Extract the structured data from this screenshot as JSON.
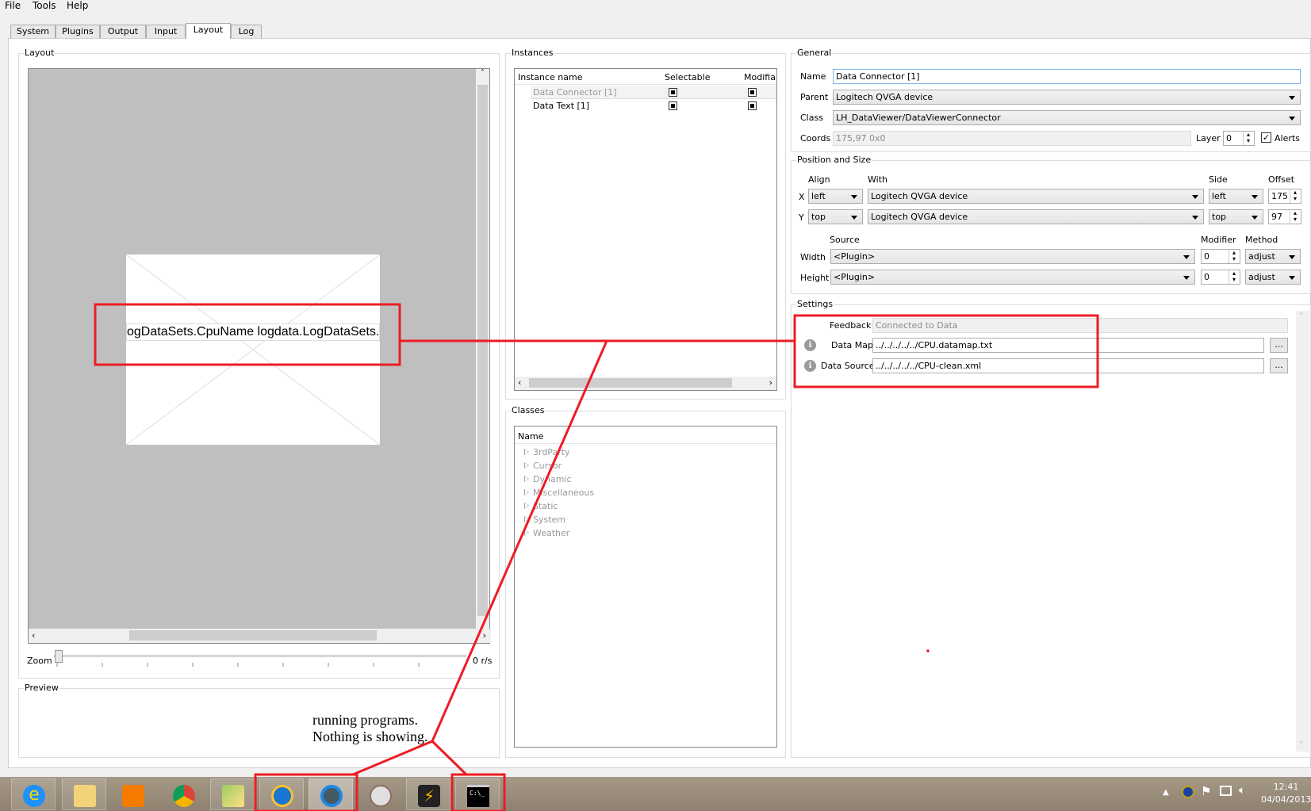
{
  "menu": [
    "File",
    "Tools",
    "Help"
  ],
  "tabs": [
    "System",
    "Plugins",
    "Output",
    "Input",
    "Layout",
    "Log"
  ],
  "active_tab": "Layout",
  "layout": {
    "title": "Layout",
    "canvas_text": "ogDataSets.CpuName logdata.LogDataSets.",
    "zoom_label": "Zoom",
    "rate": "0 r/s",
    "zoom_value": 0
  },
  "preview": {
    "title": "Preview"
  },
  "instances": {
    "title": "Instances",
    "columns": [
      "Instance name",
      "Selectable",
      "Modifiable"
    ],
    "rows": [
      {
        "name": "Data Connector [1]",
        "selectable": true,
        "modifiable": true
      },
      {
        "name": "Data Text [1]",
        "selectable": true,
        "modifiable": true
      }
    ]
  },
  "classes": {
    "title": "Classes",
    "column": "Name",
    "items": [
      "3rdParty",
      "Cursor",
      "Dynamic",
      "Miscellaneous",
      "Static",
      "System",
      "Weather"
    ]
  },
  "general": {
    "title": "General",
    "name_label": "Name",
    "name": "Data Connector [1]",
    "parent_label": "Parent",
    "parent": "Logitech QVGA device",
    "class_label": "Class",
    "class": "LH_DataViewer/DataViewerConnector",
    "coords_label": "Coords",
    "coords": "175,97 0x0",
    "layer_label": "Layer",
    "layer": "0",
    "alerts_label": "Alerts",
    "alerts": true
  },
  "position": {
    "title": "Position and Size",
    "h_align": "Align",
    "h_with": "With",
    "h_side": "Side",
    "h_offset": "Offset",
    "x": {
      "label": "X",
      "align": "left",
      "with": "Logitech QVGA device",
      "side": "left",
      "offset": "175"
    },
    "y": {
      "label": "Y",
      "align": "top",
      "with": "Logitech QVGA device",
      "side": "top",
      "offset": "97"
    },
    "h_source": "Source",
    "h_modifier": "Modifier",
    "h_method": "Method",
    "width": {
      "label": "Width",
      "source": "<Plugin>",
      "modifier": "0",
      "method": "adjust"
    },
    "height": {
      "label": "Height",
      "source": "<Plugin>",
      "modifier": "0",
      "method": "adjust"
    }
  },
  "settings": {
    "title": "Settings",
    "feedback_label": "Feedback",
    "feedback": "Connected to Data",
    "datamap_label": "Data Map",
    "datamap": "../../../../../CPU.datamap.txt",
    "datasource_label": "Data Source",
    "datasource": "../../../../../CPU-clean.xml",
    "browse": "..."
  },
  "annotation": {
    "line1": "running programs.",
    "line2": "Nothing is showing.",
    "color": "#ed1c24"
  },
  "taskbar": {
    "apps": [
      "internet-explorer",
      "file-explorer",
      "media-player",
      "chrome",
      "windows-app",
      "sync-app",
      "circle-app",
      "paint",
      "winamp",
      "command-prompt"
    ],
    "time": "12:41",
    "date": "04/04/2013"
  }
}
